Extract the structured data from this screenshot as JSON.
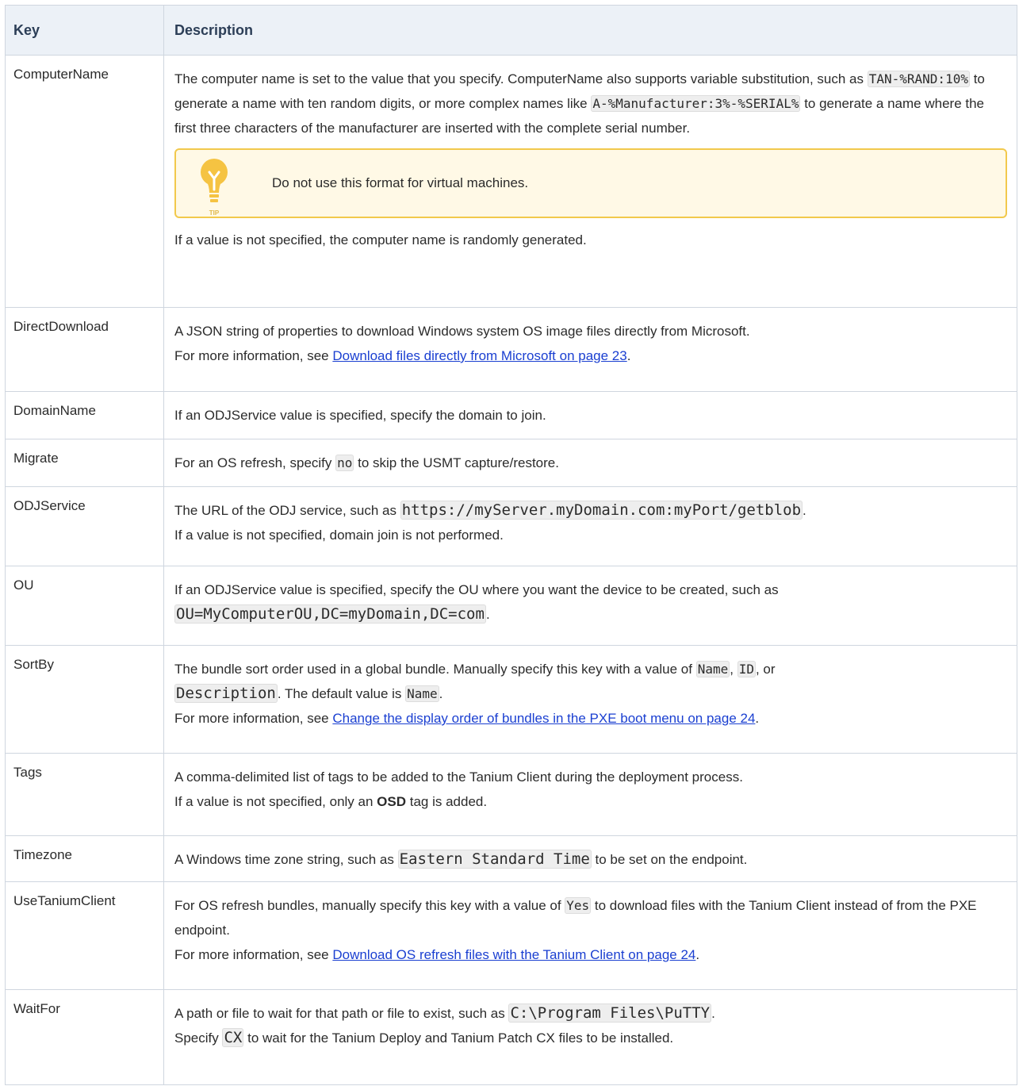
{
  "header": {
    "key": "Key",
    "description": "Description"
  },
  "rows": {
    "computername": {
      "key": "ComputerName",
      "p1a": "The computer name is set to the value that you specify. ComputerName also supports variable substitution, such as ",
      "code1": "TAN-%RAND:10%",
      "p1b": " to generate a name with ten random digits, or more complex names like ",
      "code2": "A-%Manufacturer:3%-%SERIAL%",
      "p1c": " to generate a name where the first three characters of the manufacturer are inserted with the complete serial number.",
      "tip_text": "Do not use this format for virtual machines.",
      "tip_label": "TIP",
      "p2": "If a value is not specified, the computer name is randomly generated."
    },
    "directdownload": {
      "key": "DirectDownload",
      "p1": "A JSON string of properties to download Windows system OS image files directly from Microsoft.",
      "p2a": "For more information, see ",
      "link": "Download files directly from Microsoft on page 23",
      "p2b": "."
    },
    "domainname": {
      "key": "DomainName",
      "p1": "If an ODJService value is specified, specify the domain to join."
    },
    "migrate": {
      "key": "Migrate",
      "p1a": "For an OS refresh, specify ",
      "code": "no",
      "p1b": " to skip the USMT capture/restore."
    },
    "odjservice": {
      "key": "ODJService",
      "p1a": "The URL of the ODJ service, such as ",
      "code": "https://myServer.myDomain.com:myPort/getblob",
      "p1b": ".",
      "p2": "If a value is not specified, domain join is not performed."
    },
    "ou": {
      "key": "OU",
      "p1": "If an ODJService value is specified, specify the OU where you want the device to be created, such as",
      "code": "OU=MyComputerOU,DC=myDomain,DC=com",
      "p2b": "."
    },
    "sortby": {
      "key": "SortBy",
      "p1a": "The bundle sort order used in a global bundle. Manually specify this key with a value of ",
      "code1": "Name",
      "sep1": ", ",
      "code2": "ID",
      "sep2": ", or",
      "code3": "Description",
      "p1b": ". The default value is ",
      "code4": "Name",
      "p1c": ".",
      "p2a": "For more information, see ",
      "link": "Change the display order of bundles in the PXE boot menu on page 24",
      "p2b": "."
    },
    "tags": {
      "key": "Tags",
      "p1": "A comma-delimited list of tags to be added to the Tanium Client during the deployment process.",
      "p2a": "If a value is not specified, only an ",
      "bold": "OSD",
      "p2b": " tag is added."
    },
    "timezone": {
      "key": "Timezone",
      "p1a": "A Windows time zone string, such as ",
      "code": "Eastern Standard Time",
      "p1b": " to be set on the endpoint."
    },
    "usetaniumclient": {
      "key": "UseTaniumClient",
      "p1a": "For OS refresh bundles, manually specify this key with a value of ",
      "code": "Yes",
      "p1b": " to download files with the Tanium Client instead of from the PXE endpoint.",
      "p2a": "For more information, see ",
      "link": "Download OS refresh files with the Tanium Client on page 24",
      "p2b": "."
    },
    "waitfor": {
      "key": "WaitFor",
      "p1a": "A path or file to wait for that path or file to exist, such as ",
      "code": "C:\\Program Files\\PuTTY",
      "p1b": ".",
      "p2a": "Specify ",
      "code2": "CX",
      "p2b": " to wait for the Tanium Deploy and Tanium Patch CX files to be installed."
    }
  }
}
